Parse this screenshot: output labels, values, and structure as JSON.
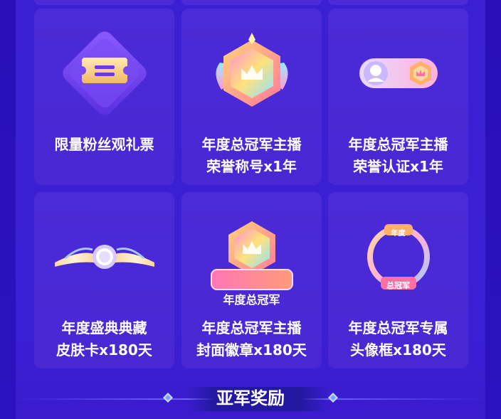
{
  "rewards": [
    {
      "line1": "限量粉丝观礼票",
      "line2": "",
      "icon": "ticket-icon"
    },
    {
      "line1": "年度总冠军主播",
      "line2": "荣誉称号x1年",
      "icon": "crown-badge-icon"
    },
    {
      "line1": "年度总冠军主播",
      "line2": "荣誉认证x1年",
      "icon": "verification-badge-icon"
    },
    {
      "line1": "年度盛典典藏",
      "line2": "皮肤卡x180天",
      "icon": "wing-skin-icon"
    },
    {
      "line1": "年度总冠军主播",
      "line2": "封面徽章x180天",
      "icon": "cover-badge-icon"
    },
    {
      "line1": "年度总冠军专属",
      "line2": "头像框x180天",
      "icon": "avatar-frame-icon"
    }
  ],
  "badge_text": {
    "cover_badge": "年度总冠军",
    "frame_top": "年度",
    "frame_bottom": "总冠军"
  },
  "section": {
    "title": "亚军奖励"
  },
  "colors": {
    "bg": "#2a0fb8",
    "panel": "#3b1fd3",
    "card": "#4b2ad7",
    "accent": "#ff7fb0"
  }
}
